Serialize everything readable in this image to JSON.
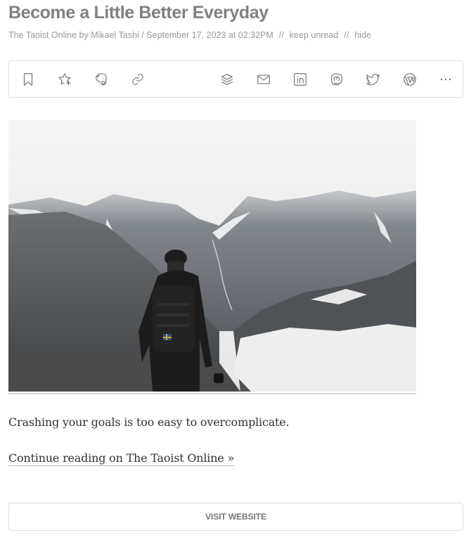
{
  "article": {
    "title": "Become a Little Better Everyday",
    "meta": {
      "byline": "The Taoist Online by Mikael Tashi / September 17, 2023 at 02:32PM",
      "separator": "//",
      "keep_unread": "keep unread",
      "hide": "hide"
    },
    "image": {
      "alt": "Hiker with backpack looking at snowy mountains under clouds"
    },
    "summary": "Crashing your goals is too easy to overcomplicate.",
    "continue_link": "Continue reading on The Taoist Online »"
  },
  "toolbar": {
    "left_icons": [
      "bookmark-icon",
      "star-plus-icon",
      "evernote-icon",
      "link-icon"
    ],
    "right_icons": [
      "buffer-icon",
      "email-icon",
      "linkedin-icon",
      "mastodon-icon",
      "twitter-icon",
      "wordpress-icon",
      "more-icon"
    ]
  },
  "visit_button": {
    "label": "VISIT WEBSITE"
  }
}
